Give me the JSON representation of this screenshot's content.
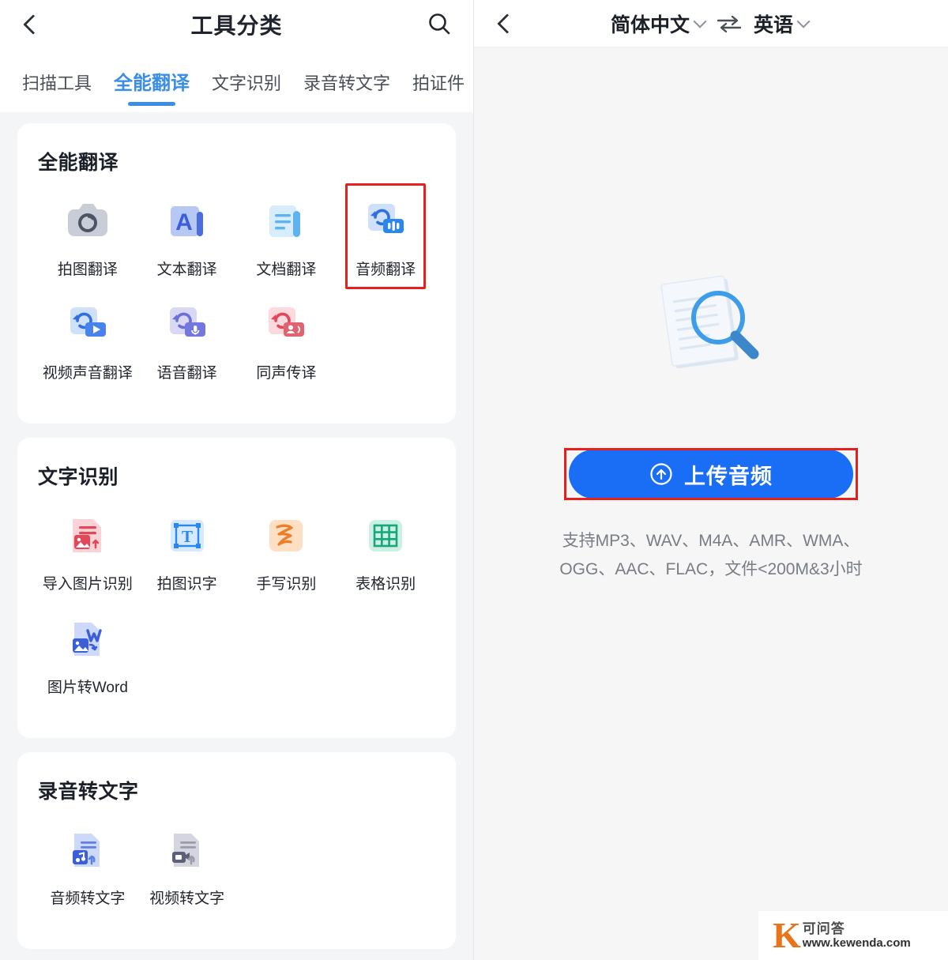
{
  "theme": {
    "accent_blue": "#3a8ee6",
    "button_blue": "#1a6ef5",
    "highlight_red": "#e8201d",
    "page_bg": "#f4f5f7",
    "card_bg": "#ffffff"
  },
  "left": {
    "header": {
      "back_icon": "back-chevron-icon",
      "title": "工具分类",
      "search_icon": "search-icon"
    },
    "tabs": [
      {
        "label": "扫描工具",
        "active": false
      },
      {
        "label": "全能翻译",
        "active": true
      },
      {
        "label": "文字识别",
        "active": false
      },
      {
        "label": "录音转文字",
        "active": false
      },
      {
        "label": "拍证件",
        "active": false
      }
    ],
    "sections": [
      {
        "title": "全能翻译",
        "items": [
          {
            "label": "拍图翻译",
            "icon": "camera-translate-icon",
            "highlighted": false
          },
          {
            "label": "文本翻译",
            "icon": "text-translate-icon",
            "highlighted": false
          },
          {
            "label": "文档翻译",
            "icon": "document-translate-icon",
            "highlighted": false
          },
          {
            "label": "音频翻译",
            "icon": "audio-translate-icon",
            "highlighted": true
          },
          {
            "label": "视频声音翻译",
            "icon": "video-audio-translate-icon",
            "highlighted": false
          },
          {
            "label": "语音翻译",
            "icon": "voice-translate-icon",
            "highlighted": false
          },
          {
            "label": "同声传译",
            "icon": "simultaneous-interpretation-icon",
            "highlighted": false
          }
        ]
      },
      {
        "title": "文字识别",
        "items": [
          {
            "label": "导入图片识别",
            "icon": "import-image-ocr-icon",
            "highlighted": false
          },
          {
            "label": "拍图识字",
            "icon": "photo-ocr-icon",
            "highlighted": false
          },
          {
            "label": "手写识别",
            "icon": "handwriting-ocr-icon",
            "highlighted": false
          },
          {
            "label": "表格识别",
            "icon": "table-ocr-icon",
            "highlighted": false
          },
          {
            "label": "图片转Word",
            "icon": "image-to-word-icon",
            "highlighted": false
          }
        ]
      },
      {
        "title": "录音转文字",
        "items": [
          {
            "label": "音频转文字",
            "icon": "audio-to-text-icon",
            "highlighted": false
          },
          {
            "label": "视频转文字",
            "icon": "video-to-text-icon",
            "highlighted": false
          }
        ]
      }
    ]
  },
  "right": {
    "header": {
      "back_icon": "back-chevron-icon",
      "source_language": "简体中文",
      "swap_icon": "swap-arrows-icon",
      "target_language": "英语"
    },
    "illustration": "document-magnifier-illustration",
    "upload_button": {
      "icon": "upload-circle-arrow-icon",
      "label": "上传音频"
    },
    "hint": "支持MP3、WAV、M4A、AMR、WMA、OGG、AAC、FLAC，文件<200M&3小时"
  },
  "watermark": {
    "logo_letter": "K",
    "name": "可问答",
    "url": "www.kewenda.com"
  }
}
